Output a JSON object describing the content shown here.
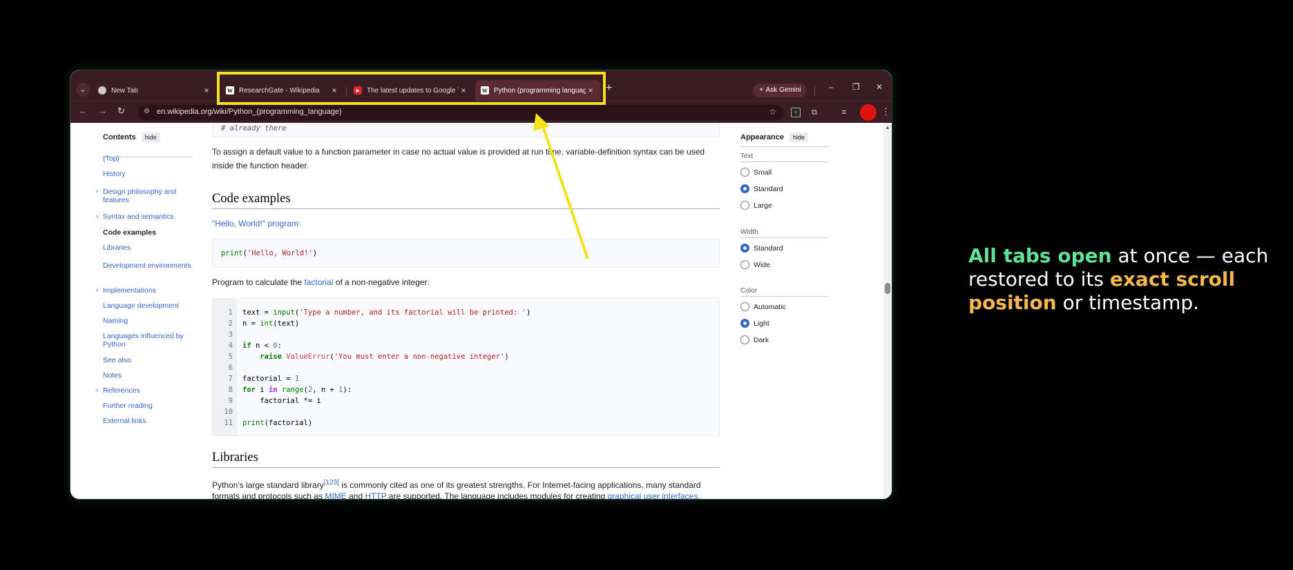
{
  "browser": {
    "tabs": [
      {
        "title": "New Tab",
        "favicon": "chrome-icon",
        "active": false
      },
      {
        "title": "ResearchGate - Wikipedia",
        "favicon": "wikipedia-icon",
        "active": false
      },
      {
        "title": "The latest updates to Google Tr",
        "favicon": "youtube-icon",
        "active": false
      },
      {
        "title": "Python (programming languag",
        "favicon": "wikipedia-icon",
        "active": true
      }
    ],
    "new_tab": "+",
    "ask_gemini": "Ask Gemini",
    "url": "en.wikipedia.org/wiki/Python_(programming_language)",
    "window_controls": {
      "minimize": "–",
      "restore": "❐",
      "close": "✕"
    }
  },
  "toc": {
    "title": "Contents",
    "hide": "hide",
    "items": [
      {
        "label": "(Top)",
        "expandable": false,
        "current": false
      },
      {
        "label": "History",
        "expandable": false,
        "current": false
      },
      {
        "label": "Design philosophy and features",
        "expandable": true,
        "current": false
      },
      {
        "label": "Syntax and semantics",
        "expandable": true,
        "current": false
      },
      {
        "label": "Code examples",
        "expandable": false,
        "current": true
      },
      {
        "label": "Libraries",
        "expandable": false,
        "current": false
      },
      {
        "label": "Development environments",
        "expandable": false,
        "current": false
      },
      {
        "label": "Implementations",
        "expandable": true,
        "current": false
      },
      {
        "label": "Language development",
        "expandable": false,
        "current": false
      },
      {
        "label": "Naming",
        "expandable": false,
        "current": false
      },
      {
        "label": "Languages influenced by Python",
        "expandable": false,
        "current": false
      },
      {
        "label": "See also",
        "expandable": false,
        "current": false
      },
      {
        "label": "Notes",
        "expandable": false,
        "current": false
      },
      {
        "label": "References",
        "expandable": true,
        "current": false
      },
      {
        "label": "Further reading",
        "expandable": false,
        "current": false
      },
      {
        "label": "External links",
        "expandable": false,
        "current": false
      }
    ]
  },
  "article": {
    "code_top": "# already there",
    "para1": "To assign a default value to a function parameter in case no actual value is provided at run time, variable-definition syntax can be used inside the function header.",
    "h_code_examples": "Code examples",
    "hello_link": "\"Hello, World!\" program:",
    "hello_code": "print('Hello, World!')",
    "factorial_para_pre": "Program to calculate the ",
    "factorial_link": "factorial",
    "factorial_para_post": " of a non-negative integer:",
    "factorial_lines": [
      "1",
      "2",
      "3",
      "4",
      "5",
      "6",
      "7",
      "8",
      "9",
      "10",
      "11"
    ],
    "h_libraries": "Libraries",
    "lib_para_1a": "Python's large standard library",
    "lib_ref": "[123]",
    "lib_para_1b": " is commonly cited as one of its greatest strengths. For Internet-facing applications, many standard",
    "lib_para_2a": "formats and protocols such as ",
    "lib_mime": "MIME",
    "lib_and": " and ",
    "lib_http": "HTTP",
    "lib_para_2b": " are supported. The language includes modules for creating ",
    "lib_gui": "graphical user interfaces,"
  },
  "appearance": {
    "title": "Appearance",
    "hide": "hide",
    "text_label": "Text",
    "text_options": [
      {
        "label": "Small",
        "selected": false
      },
      {
        "label": "Standard",
        "selected": true
      },
      {
        "label": "Large",
        "selected": false
      }
    ],
    "width_label": "Width",
    "width_options": [
      {
        "label": "Standard",
        "selected": true
      },
      {
        "label": "Wide",
        "selected": false
      }
    ],
    "color_label": "Color",
    "color_options": [
      {
        "label": "Automatic",
        "selected": false
      },
      {
        "label": "Light",
        "selected": true
      },
      {
        "label": "Dark",
        "selected": false
      }
    ]
  },
  "caption": {
    "part1": "All tabs open",
    "part2": " at once — each restored to its ",
    "part3": "exact scroll position",
    "part4": " or timestamp."
  },
  "colors": {
    "highlight": "#f4e21a",
    "caption_green": "#5ee39a",
    "caption_orange": "#f4b84c"
  }
}
